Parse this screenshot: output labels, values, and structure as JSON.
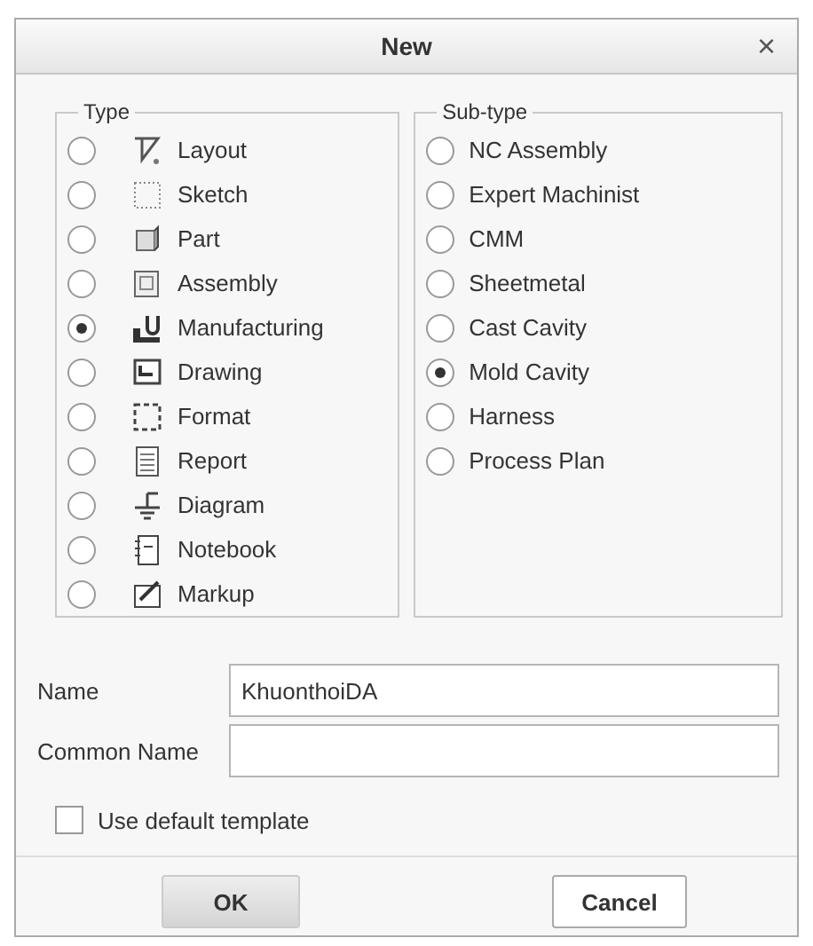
{
  "window": {
    "title": "New",
    "close": "×"
  },
  "type_group": {
    "title": "Type",
    "items": [
      {
        "label": "Layout",
        "selected": false
      },
      {
        "label": "Sketch",
        "selected": false
      },
      {
        "label": "Part",
        "selected": false
      },
      {
        "label": "Assembly",
        "selected": false
      },
      {
        "label": "Manufacturing",
        "selected": true
      },
      {
        "label": "Drawing",
        "selected": false
      },
      {
        "label": "Format",
        "selected": false
      },
      {
        "label": "Report",
        "selected": false
      },
      {
        "label": "Diagram",
        "selected": false
      },
      {
        "label": "Notebook",
        "selected": false
      },
      {
        "label": "Markup",
        "selected": false
      }
    ]
  },
  "subtype_group": {
    "title": "Sub-type",
    "items": [
      {
        "label": "NC Assembly",
        "selected": false
      },
      {
        "label": "Expert Machinist",
        "selected": false
      },
      {
        "label": "CMM",
        "selected": false
      },
      {
        "label": "Sheetmetal",
        "selected": false
      },
      {
        "label": "Cast Cavity",
        "selected": false
      },
      {
        "label": "Mold Cavity",
        "selected": true
      },
      {
        "label": "Harness",
        "selected": false
      },
      {
        "label": "Process Plan",
        "selected": false
      }
    ]
  },
  "fields": [
    {
      "label": "Name",
      "value": "KhuonthoiDA"
    },
    {
      "label": "Common Name"
    }
  ],
  "use_default_template": {
    "label": "Use default template",
    "checked": false
  },
  "buttons": [
    {
      "label": "OK",
      "kind": "default"
    },
    {
      "label": "Cancel",
      "kind": "normal"
    }
  ]
}
